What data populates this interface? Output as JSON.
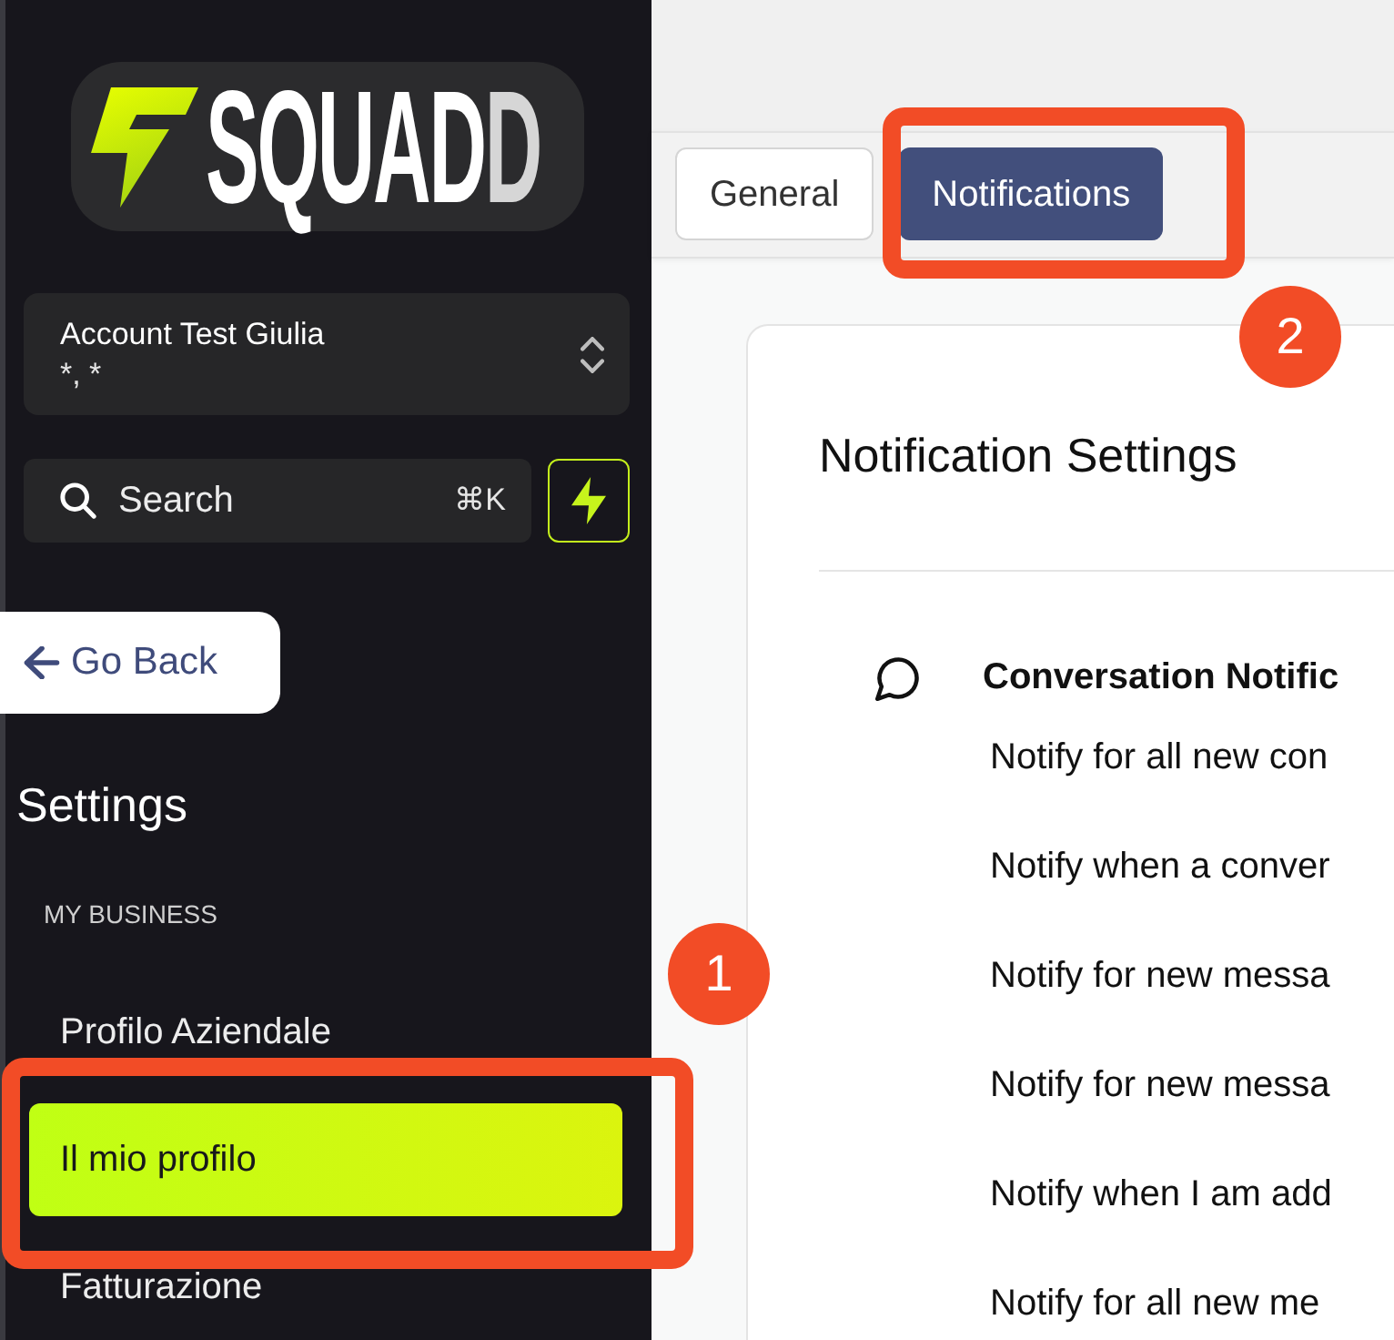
{
  "sidebar": {
    "logo": {
      "wordmark": [
        "SQUAD",
        "D"
      ]
    },
    "account": {
      "name": "Account Test Giulia",
      "subtitle": "*, *"
    },
    "search": {
      "label": "Search",
      "shortcut": "⌘K"
    },
    "back_button": {
      "label": "Go Back"
    },
    "title": "Settings",
    "sections": [
      {
        "heading": "MY BUSINESS",
        "items": [
          {
            "label": "Profilo Aziendale",
            "selected": false
          },
          {
            "label": "Il mio profilo",
            "selected": true
          },
          {
            "label": "Fatturazione",
            "selected": false
          }
        ]
      }
    ]
  },
  "tabs": [
    {
      "label": "General",
      "selected": false
    },
    {
      "label": "Notifications",
      "selected": true
    }
  ],
  "notification_settings": {
    "title": "Notification Settings",
    "groups": [
      {
        "title": "Conversation Notific",
        "options": [
          "Notify for all new con",
          "Notify when a conver",
          "Notify for new messa",
          "Notify for new messa",
          "Notify when I am add",
          "Notify for all new me"
        ]
      }
    ]
  },
  "annotations": [
    {
      "label": "1"
    },
    {
      "label": "2"
    }
  ]
}
